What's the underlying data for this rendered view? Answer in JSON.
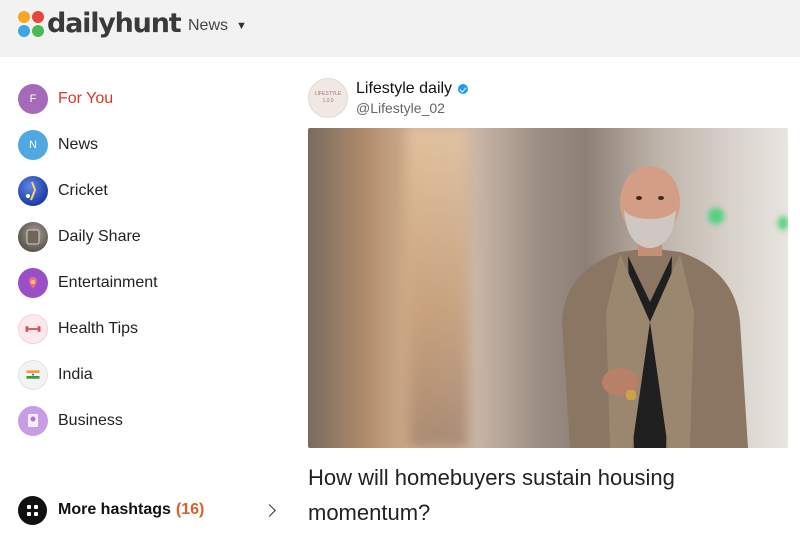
{
  "brand": {
    "logo_text": "dailyhunt"
  },
  "topnav": {
    "news_label": "News",
    "caret": "▼"
  },
  "sidebar": {
    "items": [
      {
        "label": "For You",
        "icon_text": "F",
        "icon_color": "#a56ab8",
        "active": true
      },
      {
        "label": "News",
        "icon_text": "N",
        "icon_color": "#4fa8e0"
      },
      {
        "label": "Cricket",
        "icon": "cricket-icon"
      },
      {
        "label": "Daily Share",
        "icon": "daily-share-icon"
      },
      {
        "label": "Entertainment",
        "icon": "entertainment-icon"
      },
      {
        "label": "Health Tips",
        "icon": "dumbbell-icon"
      },
      {
        "label": "India",
        "icon": "india-flag-icon"
      },
      {
        "label": "Business",
        "icon": "business-icon"
      }
    ]
  },
  "more": {
    "label": "More hashtags",
    "count": "(16)"
  },
  "post": {
    "publisher_name": "Lifestyle daily",
    "publisher_handle": "@Lifestyle_02",
    "avatar_text_1": "LIFESTYLE",
    "avatar_text_2": "1.0.0",
    "headline": "How will homebuyers sustain housing momentum?"
  },
  "colors": {
    "accent": "#d9372b",
    "count": "#d9602b",
    "topbar": "#f2f2f2"
  }
}
